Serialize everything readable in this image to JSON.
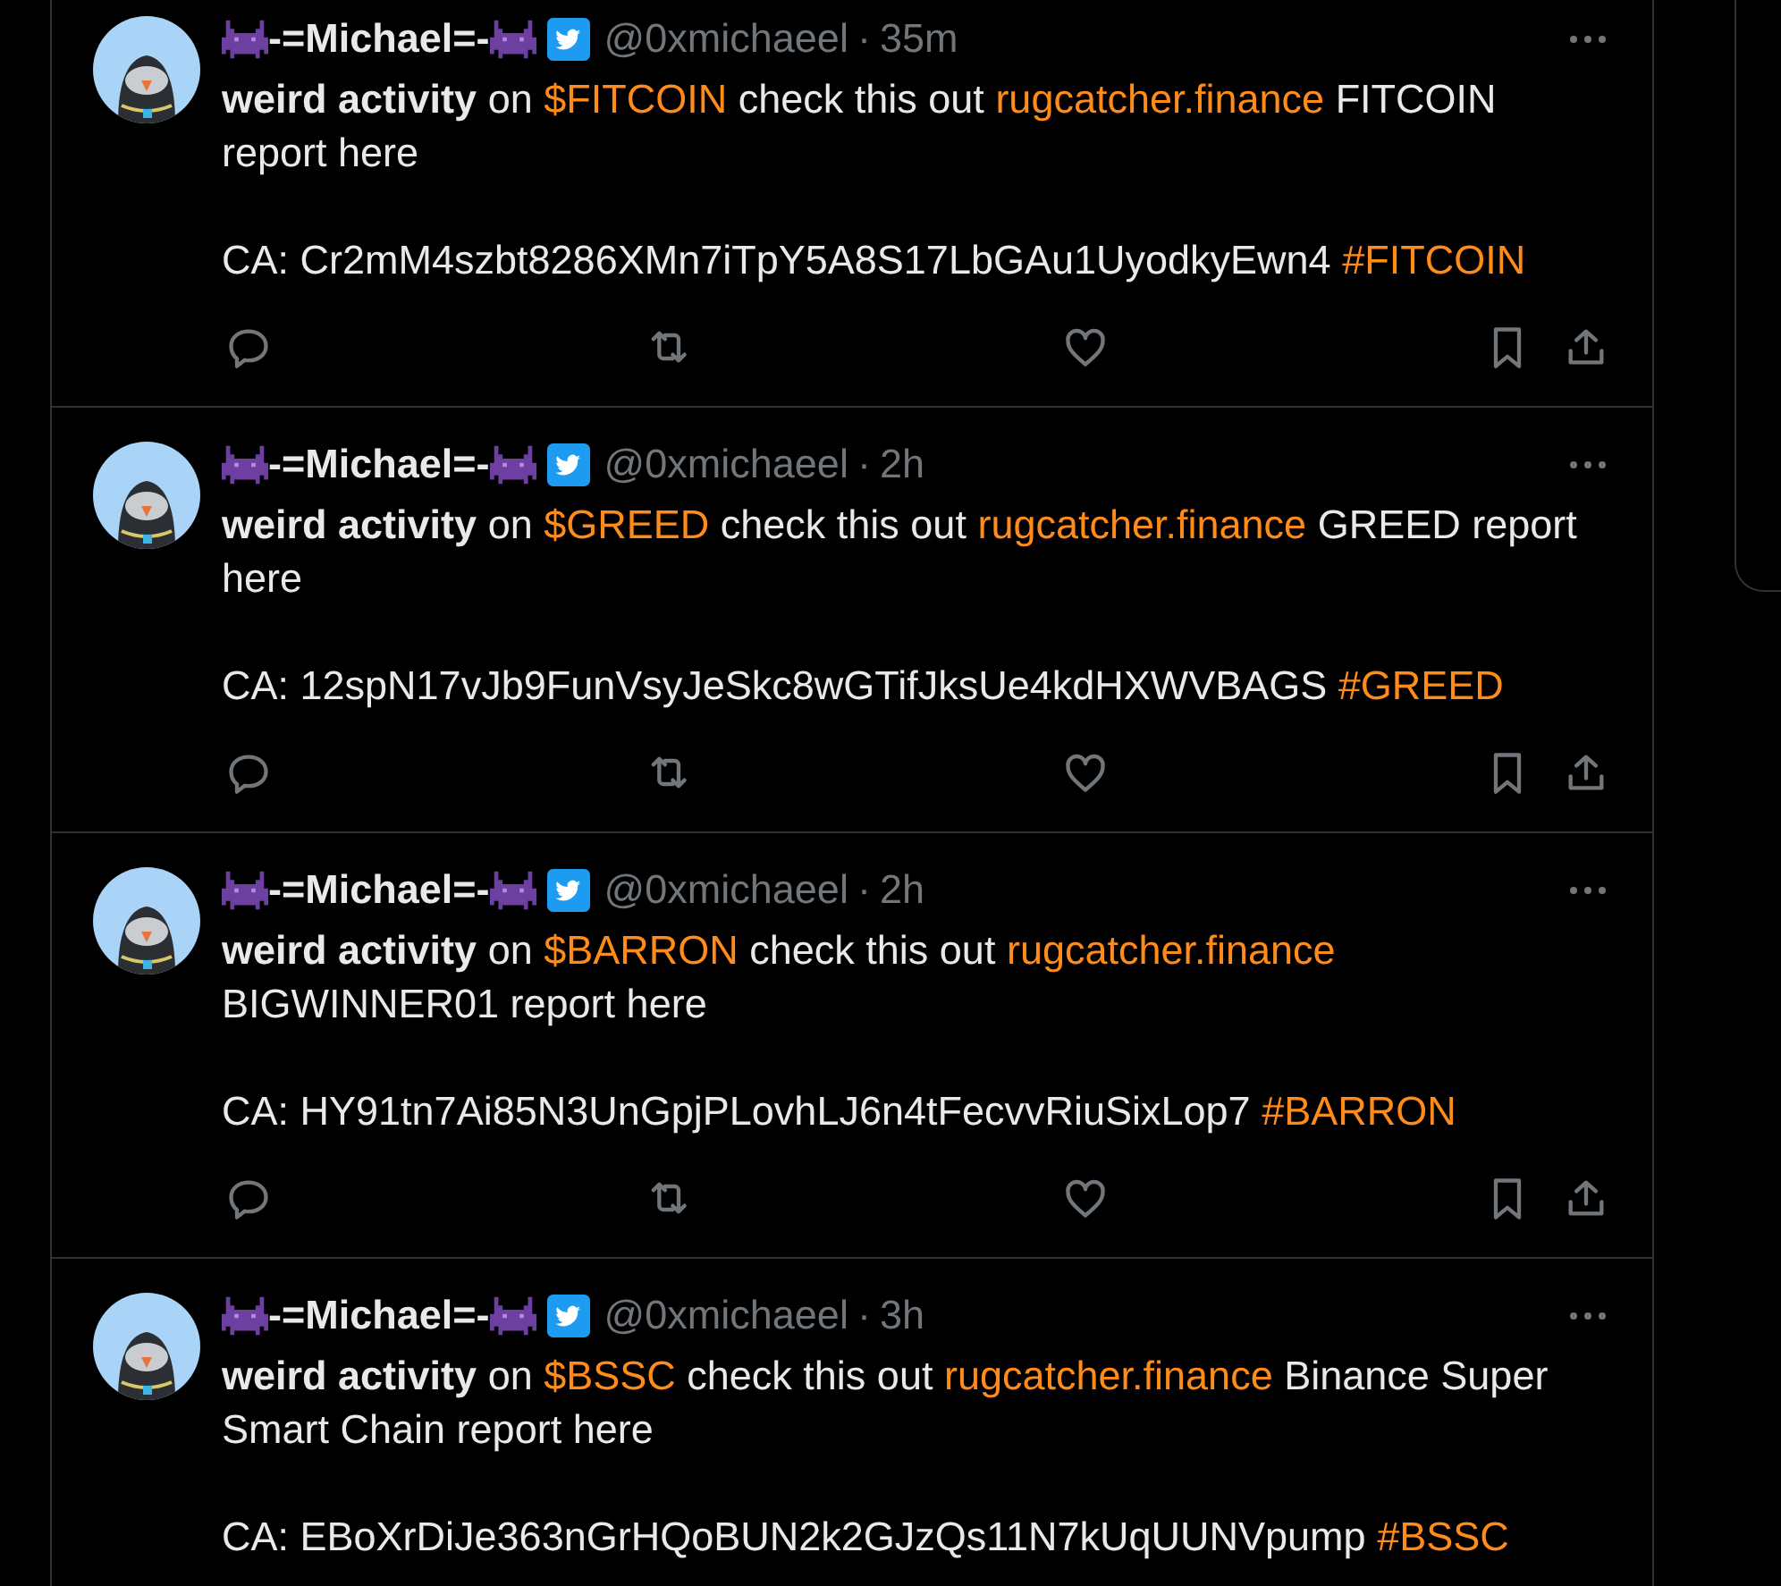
{
  "tweets": [
    {
      "name": "-=Michael=-",
      "handle": "@0xmichaeel",
      "separator": "·",
      "time": "35m",
      "actions": true,
      "paragraphs": [
        [
          {
            "kind": "strong",
            "text": "weird activity"
          },
          {
            "kind": "text",
            "text": " on "
          },
          {
            "kind": "cashtag",
            "text": "$FITCOIN"
          },
          {
            "kind": "text",
            "text": " check this out "
          },
          {
            "kind": "url",
            "text": "rugcatcher.finance"
          },
          {
            "kind": "text",
            "text": " FITCOIN report here"
          }
        ],
        [
          {
            "kind": "text",
            "text": "CA: Cr2mM4szbt8286XMn7iTpY5A8S17LbGAu1UyodkyEwn4 "
          },
          {
            "kind": "hashtag",
            "text": "#FITCOIN"
          }
        ]
      ]
    },
    {
      "name": "-=Michael=-",
      "handle": "@0xmichaeel",
      "separator": "·",
      "time": "2h",
      "actions": true,
      "paragraphs": [
        [
          {
            "kind": "strong",
            "text": "weird activity"
          },
          {
            "kind": "text",
            "text": " on "
          },
          {
            "kind": "cashtag",
            "text": "$GREED"
          },
          {
            "kind": "text",
            "text": " check this out "
          },
          {
            "kind": "url",
            "text": "rugcatcher.finance"
          },
          {
            "kind": "text",
            "text": " GREED report here"
          }
        ],
        [
          {
            "kind": "text",
            "text": "CA: 12spN17vJb9FunVsyJeSkc8wGTifJksUe4kdHXWVBAGS "
          },
          {
            "kind": "hashtag",
            "text": "#GREED"
          }
        ]
      ]
    },
    {
      "name": "-=Michael=-",
      "handle": "@0xmichaeel",
      "separator": "·",
      "time": "2h",
      "actions": true,
      "paragraphs": [
        [
          {
            "kind": "strong",
            "text": "weird activity"
          },
          {
            "kind": "text",
            "text": " on "
          },
          {
            "kind": "cashtag",
            "text": "$BARRON"
          },
          {
            "kind": "text",
            "text": " check this out "
          },
          {
            "kind": "url",
            "text": "rugcatcher.finance"
          },
          {
            "kind": "text",
            "text": " BIGWINNER01 report here"
          }
        ],
        [
          {
            "kind": "text",
            "text": "CA: HY91tn7Ai85N3UnGpjPLovhLJ6n4tFecvvRiuSixLop7 "
          },
          {
            "kind": "hashtag",
            "text": "#BARRON"
          }
        ]
      ]
    },
    {
      "name": "-=Michael=-",
      "handle": "@0xmichaeel",
      "separator": "·",
      "time": "3h",
      "actions": false,
      "paragraphs": [
        [
          {
            "kind": "strong",
            "text": "weird activity"
          },
          {
            "kind": "text",
            "text": " on "
          },
          {
            "kind": "cashtag",
            "text": "$BSSC"
          },
          {
            "kind": "text",
            "text": " check this out "
          },
          {
            "kind": "url",
            "text": "rugcatcher.finance"
          },
          {
            "kind": "text",
            "text": " Binance Super Smart Chain report here"
          }
        ],
        [
          {
            "kind": "text",
            "text": "CA: EBoXrDiJe363nGrHQoBUN2k2GJzQs11N7kUqUUNVpump "
          },
          {
            "kind": "hashtag",
            "text": "#BSSC"
          }
        ]
      ]
    }
  ]
}
